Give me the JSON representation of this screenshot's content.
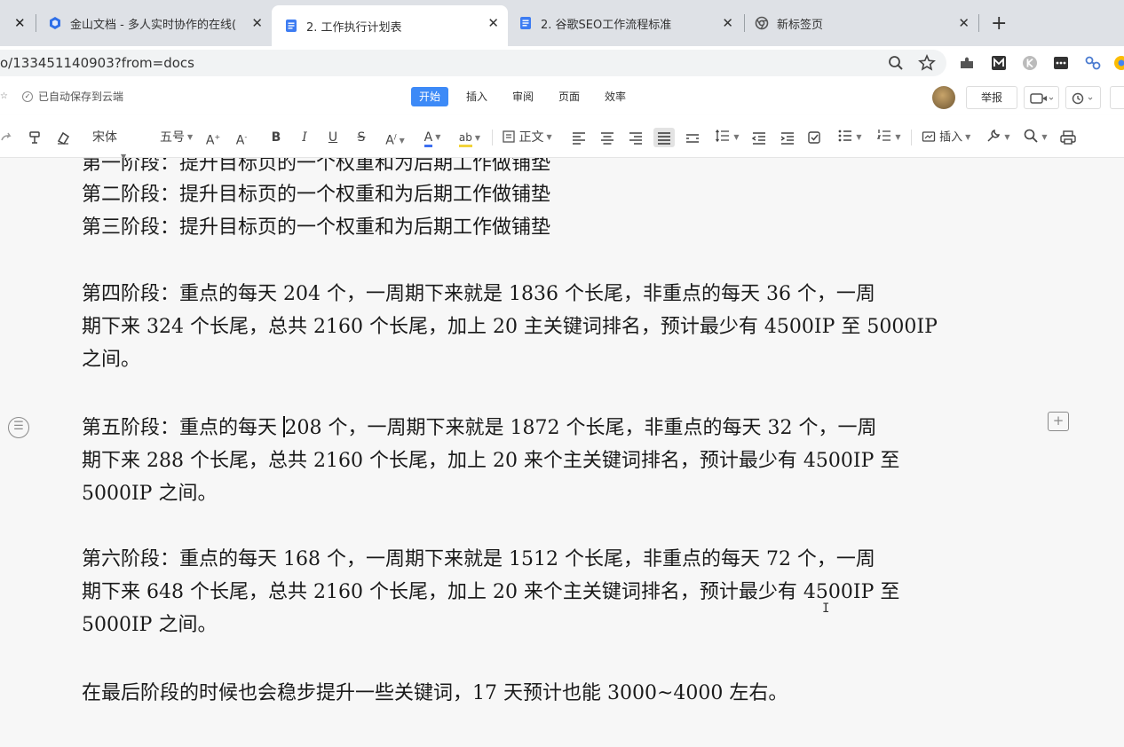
{
  "browser": {
    "tabs": [
      {
        "title": "金山文档 - 多人实时协作的在线(",
        "icon": "kdocs-logo-icon"
      },
      {
        "title": "2. 工作执行计划表",
        "icon": "document-icon",
        "active": true
      },
      {
        "title": "2. 谷歌SEO工作流程标准",
        "icon": "document-icon"
      },
      {
        "title": "新标签页",
        "icon": "chrome-icon"
      }
    ],
    "close_glyph": "✕",
    "new_tab_glyph": "+",
    "url": "o/133451140903?from=docs"
  },
  "app": {
    "autosave_text": "已自动保存到云端",
    "menu_tabs": [
      "开始",
      "插入",
      "审阅",
      "页面",
      "效率"
    ],
    "active_menu": "开始",
    "report_label": "举报"
  },
  "toolbar": {
    "font_name": "宋体",
    "font_size": "五号",
    "style_name": "正文",
    "insert_label": "插入"
  },
  "document": {
    "paragraphs": [
      {
        "lines": [
          "第一阶段：提升目标页的一个权重和为后期工作做铺垫"
        ]
      },
      {
        "lines": [
          "第二阶段：提升目标页的一个权重和为后期工作做铺垫"
        ]
      },
      {
        "lines": [
          "第三阶段：提升目标页的一个权重和为后期工作做铺垫"
        ]
      },
      {
        "lines": [
          "第四阶段：重点的每天 204 个，一周期下来就是 1836 个长尾，非重点的每天 36 个，一周",
          "期下来 324 个长尾，总共 2160 个长尾，加上 20 主关键词排名，预计最少有 4500IP 至 5000IP",
          "之间。"
        ]
      },
      {
        "lines": [
          "第五阶段：重点的每天 208 个，一周期下来就是 1872 个长尾，非重点的每天 32 个，一周",
          "期下来 288 个长尾，总共 2160 个长尾，加上 20 来个主关键词排名，预计最少有 4500IP 至",
          "5000IP 之间。"
        ]
      },
      {
        "lines": [
          "第六阶段：重点的每天 168 个，一周期下来就是 1512 个长尾，非重点的每天 72 个，一周",
          "期下来 648 个长尾，总共 2160 个长尾，加上 20 来个主关键词排名，预计最少有 4500IP 至",
          "5000IP 之间。"
        ]
      },
      {
        "lines": [
          "在最后阶段的时候也会稳步提升一些关键词，17 天预计也能 3000~4000 左右。"
        ]
      }
    ]
  },
  "colors": {
    "accent": "#3d8af7",
    "tabbar": "#dee1e6",
    "doc_bg": "#f7f7f7"
  }
}
